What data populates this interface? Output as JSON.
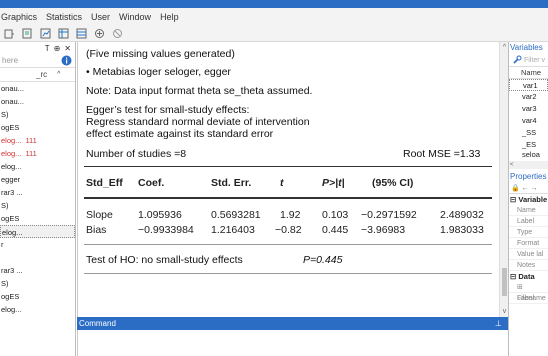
{
  "menu": [
    "Graphics",
    "Statistics",
    "User",
    "Window",
    "Help"
  ],
  "left_panel": {
    "header_icons": [
      "T",
      "⊕",
      "✕"
    ],
    "search_placeholder": "here",
    "column_header": "_rc",
    "rows": [
      {
        "text": "onau...",
        "count": "",
        "style": "normal"
      },
      {
        "text": "onau...",
        "count": "",
        "style": "normal"
      },
      {
        "text": "S)",
        "count": "",
        "style": "normal"
      },
      {
        "text": "ogES",
        "count": "",
        "style": "normal"
      },
      {
        "text": "elog...",
        "count": "111",
        "style": "red"
      },
      {
        "text": "elog...",
        "count": "111",
        "style": "red"
      },
      {
        "text": "elog...",
        "count": "",
        "style": "normal"
      },
      {
        "text": "egger",
        "count": "",
        "style": "normal"
      },
      {
        "text": "rar3 ...",
        "count": "",
        "style": "normal"
      },
      {
        "text": "S)",
        "count": "",
        "style": "normal"
      },
      {
        "text": "ogES",
        "count": "",
        "style": "normal"
      },
      {
        "text": "elog...",
        "count": "",
        "style": "selected"
      },
      {
        "text": "r",
        "count": "",
        "style": "normal"
      },
      {
        "text": "",
        "count": "",
        "style": "normal"
      },
      {
        "text": "rar3 ...",
        "count": "",
        "style": "normal"
      },
      {
        "text": "S)",
        "count": "",
        "style": "normal"
      },
      {
        "text": "ogES",
        "count": "",
        "style": "normal"
      },
      {
        "text": "elog...",
        "count": "",
        "style": "normal"
      }
    ]
  },
  "results": {
    "missing_note": "(Five missing values generated)",
    "command_echo": "• Metabias loger seloger, egger",
    "format_note": "Note: Data input format theta se_theta assumed.",
    "egger_title": "Egger’s test for small-study effects:",
    "egger_line2": "Regress standard normal deviate of intervention",
    "egger_line3": "effect estimate against its standard error",
    "n_studies": "Number of studies =8",
    "root_mse": "Root MSE =1.33",
    "table": {
      "headers": [
        "Std_Eff",
        "Coef.",
        "Std. Err.",
        "t",
        "P>|t|",
        "(95% CI)"
      ],
      "rows": [
        [
          "Slope",
          "1.095936",
          "0.5693281",
          "1.92",
          "0.103",
          "−0.2971592",
          "2.489032"
        ],
        [
          "Bias",
          "−0.9933984",
          "1.216403",
          "−0.82",
          "0.445",
          "−3.96983",
          "1.983033"
        ]
      ]
    },
    "test_label": "Test of HO: no small-study effects",
    "test_p": "P=0.445"
  },
  "command_pane": {
    "title": "Command",
    "pin": "⊥"
  },
  "right_panel": {
    "variables_title": "Variables",
    "filter_placeholder": "Filter v",
    "name_header": "Name",
    "vars": [
      "var1",
      "var2",
      "var3",
      "var4",
      "_SS",
      "_ES",
      "seloa"
    ],
    "properties_title": "Properties",
    "prop_toolbar": "🔒 ← →",
    "variables_section": "Variable",
    "prop_labels": [
      "Name",
      "Label",
      "Type",
      "Format",
      "Value lal",
      "Notes"
    ],
    "data_section": "Data",
    "data_labels": [
      "Filename",
      "Label"
    ]
  },
  "colors": {
    "accent": "#2b6cc4",
    "red_count": "#cc3333"
  }
}
